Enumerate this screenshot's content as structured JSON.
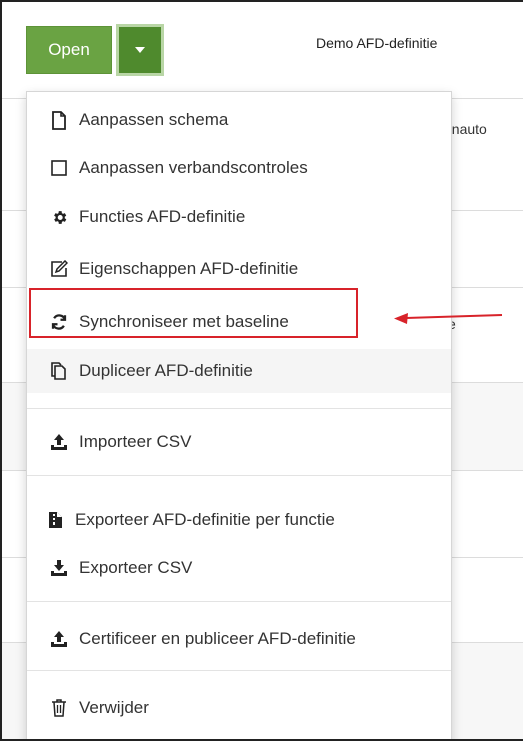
{
  "header": {
    "open_label": "Open",
    "title": "Demo AFD-definitie"
  },
  "background": {
    "row1_text": "enauto",
    "row2_text": "e"
  },
  "menu": {
    "items": [
      {
        "label": "Aanpassen schema",
        "icon": "file-icon"
      },
      {
        "label": "Aanpassen verbandscontroles",
        "icon": "square-icon"
      },
      {
        "label": "Functies AFD-definitie",
        "icon": "gear-icon"
      },
      {
        "label": "Eigenschappen AFD-definitie",
        "icon": "edit-icon"
      },
      {
        "label": "Synchroniseer met baseline",
        "icon": "sync-icon"
      },
      {
        "label": "Dupliceer AFD-definitie",
        "icon": "copy-icon"
      },
      {
        "label": "Importeer CSV",
        "icon": "upload-icon"
      },
      {
        "label": "Exporteer AFD-definitie per functie",
        "icon": "file-export-icon"
      },
      {
        "label": "Exporteer CSV",
        "icon": "download-icon"
      },
      {
        "label": "Certificeer en publiceer AFD-definitie",
        "icon": "upload-icon"
      },
      {
        "label": "Verwijder",
        "icon": "trash-icon"
      }
    ]
  },
  "colors": {
    "open_button": "#6aa343",
    "caret_button": "#4f8a2d",
    "highlight": "#d8232a"
  }
}
